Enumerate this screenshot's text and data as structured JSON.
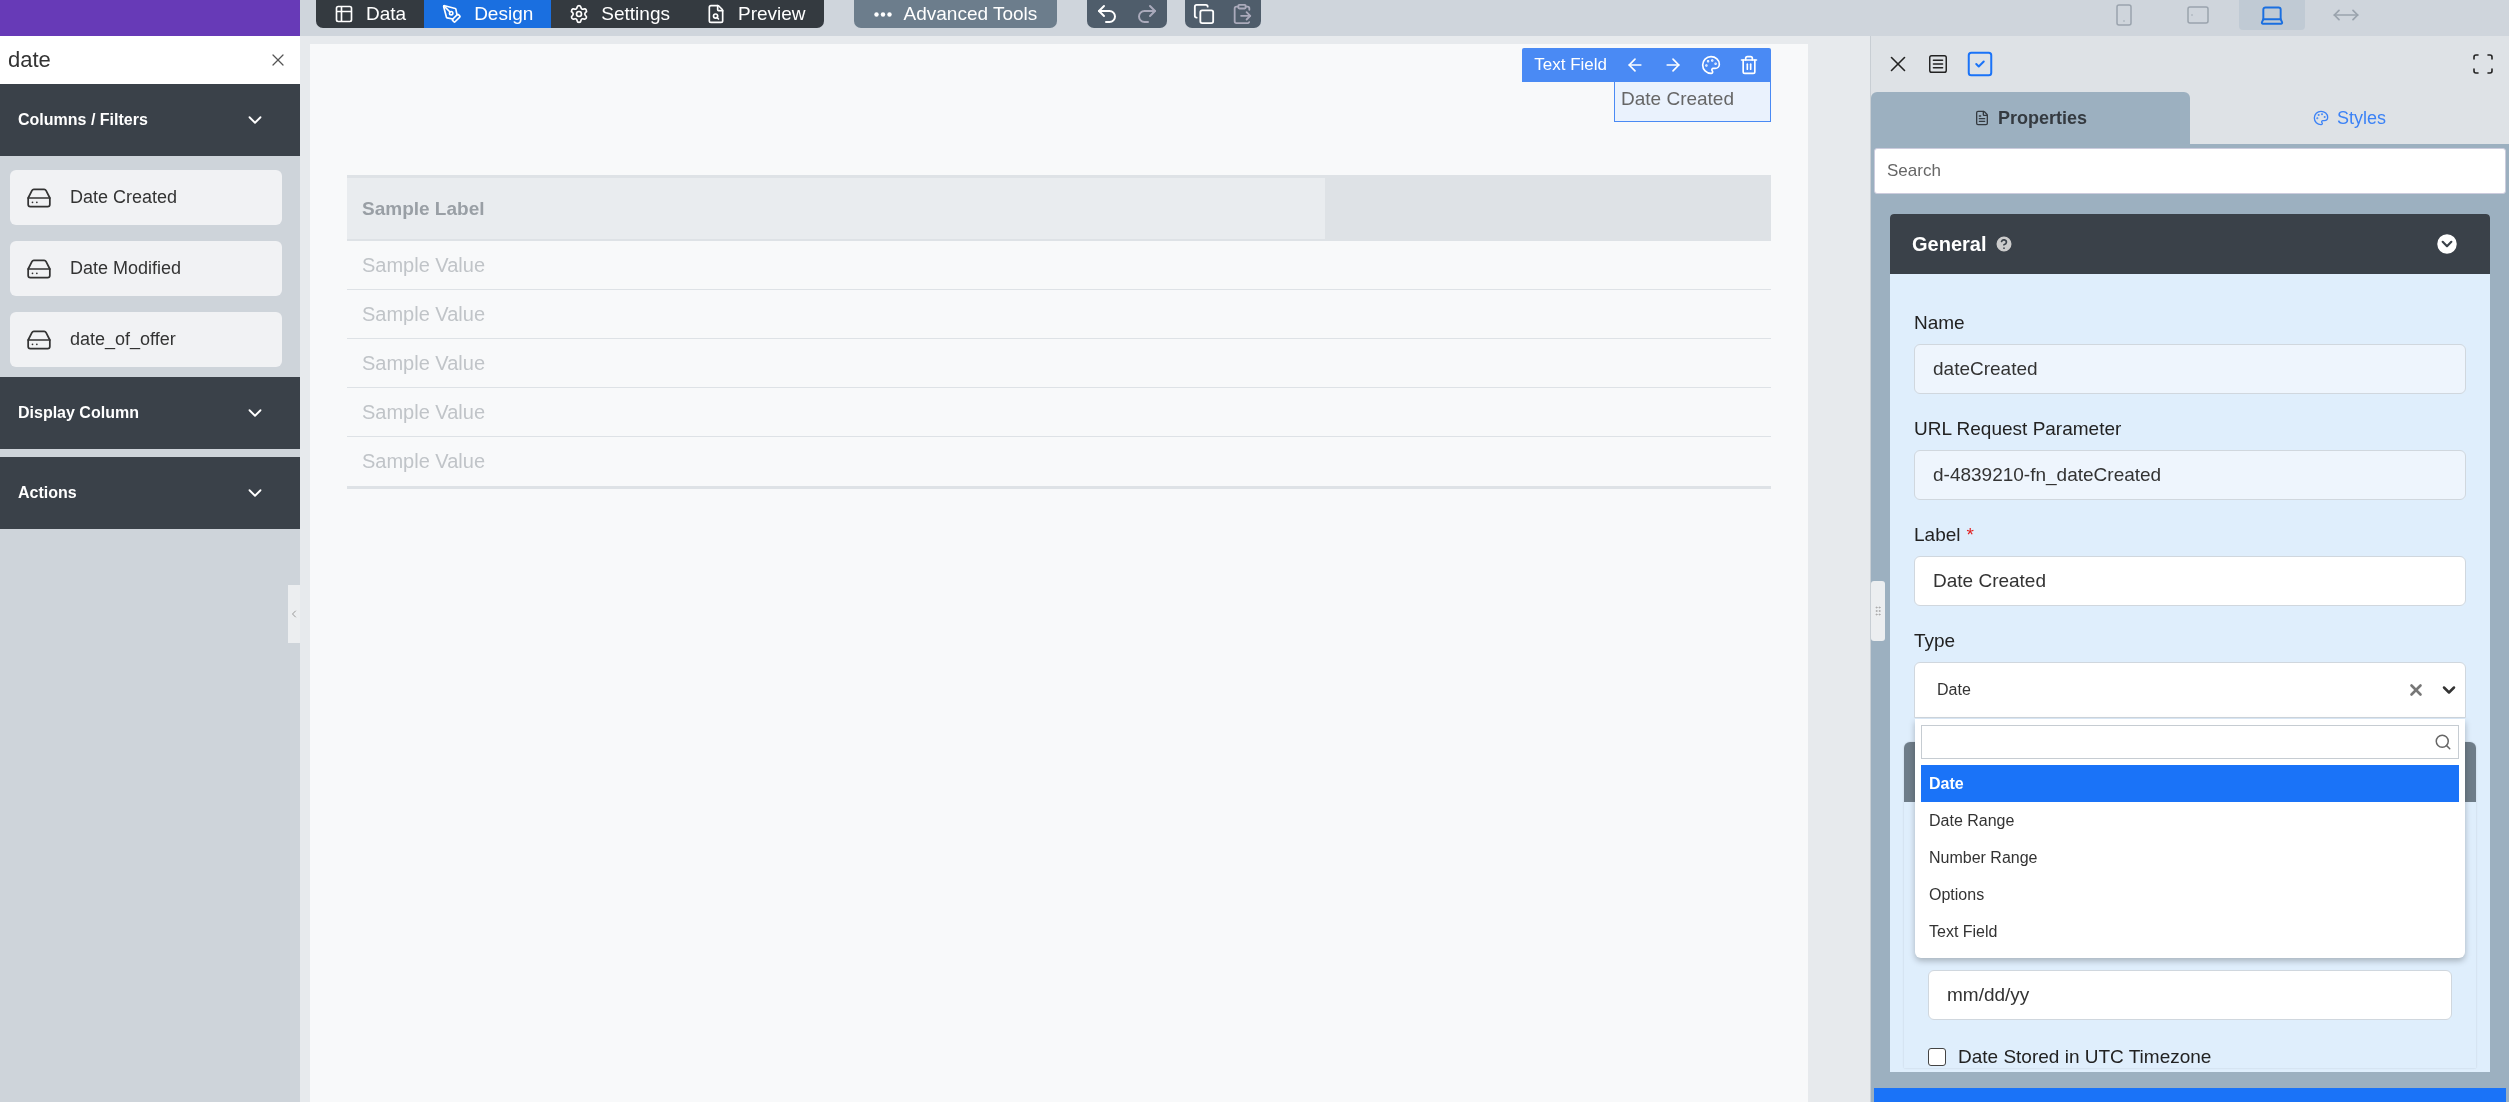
{
  "top_bar": {
    "mode_tabs": [
      {
        "label": "Data",
        "kind": "data",
        "selected": false
      },
      {
        "label": "Design",
        "kind": "design",
        "selected": true
      },
      {
        "label": "Settings",
        "kind": "settings",
        "selected": false
      },
      {
        "label": "Preview",
        "kind": "preview",
        "selected": false
      }
    ],
    "advanced_tools": "Advanced Tools",
    "devices": [
      {
        "kind": "phone",
        "selected": false
      },
      {
        "kind": "tablet",
        "selected": false
      },
      {
        "kind": "laptop",
        "selected": true
      },
      {
        "kind": "fluid",
        "selected": false
      }
    ]
  },
  "sidebar": {
    "search": {
      "value": "date"
    },
    "sections": [
      {
        "title": "Columns / Filters",
        "items": [
          "Date Created",
          "Date Modified",
          "date_of_offer"
        ]
      },
      {
        "title": "Display Column"
      },
      {
        "title": "Actions"
      }
    ]
  },
  "canvas": {
    "element_toolbar": {
      "label": "Text Field"
    },
    "selected_field": {
      "value": "Date Created"
    },
    "table": {
      "columns": [
        "Sample Label"
      ],
      "rows": [
        "Sample Value",
        "Sample Value",
        "Sample Value",
        "Sample Value",
        "Sample Value"
      ]
    }
  },
  "properties_panel": {
    "tabs": [
      {
        "label": "Properties",
        "kind": "properties",
        "selected": true
      },
      {
        "label": "Styles",
        "kind": "styles",
        "selected": false
      }
    ],
    "search": {
      "placeholder": "Search"
    },
    "section": {
      "title": "General",
      "fields": [
        {
          "label": "Name",
          "value": "dateCreated",
          "kind": "readonly"
        },
        {
          "label": "URL Request Parameter",
          "value": "d-4839210-fn_dateCreated",
          "kind": "readonly"
        },
        {
          "label": "Label",
          "value": "Date Created",
          "kind": "text",
          "required_mark": "*"
        },
        {
          "label": "Type",
          "value": "Date",
          "kind": "select"
        }
      ]
    },
    "type_dropdown": {
      "options": [
        {
          "label": "Date",
          "selected": true
        },
        {
          "label": "Date Range",
          "selected": false
        },
        {
          "label": "Number Range",
          "selected": false
        },
        {
          "label": "Options",
          "selected": false
        },
        {
          "label": "Text Field",
          "selected": false
        }
      ]
    },
    "format_field": {
      "value": "mm/dd/yy"
    },
    "utc_checkbox": {
      "label": "Date Stored in UTC Timezone",
      "checked": false
    }
  }
}
